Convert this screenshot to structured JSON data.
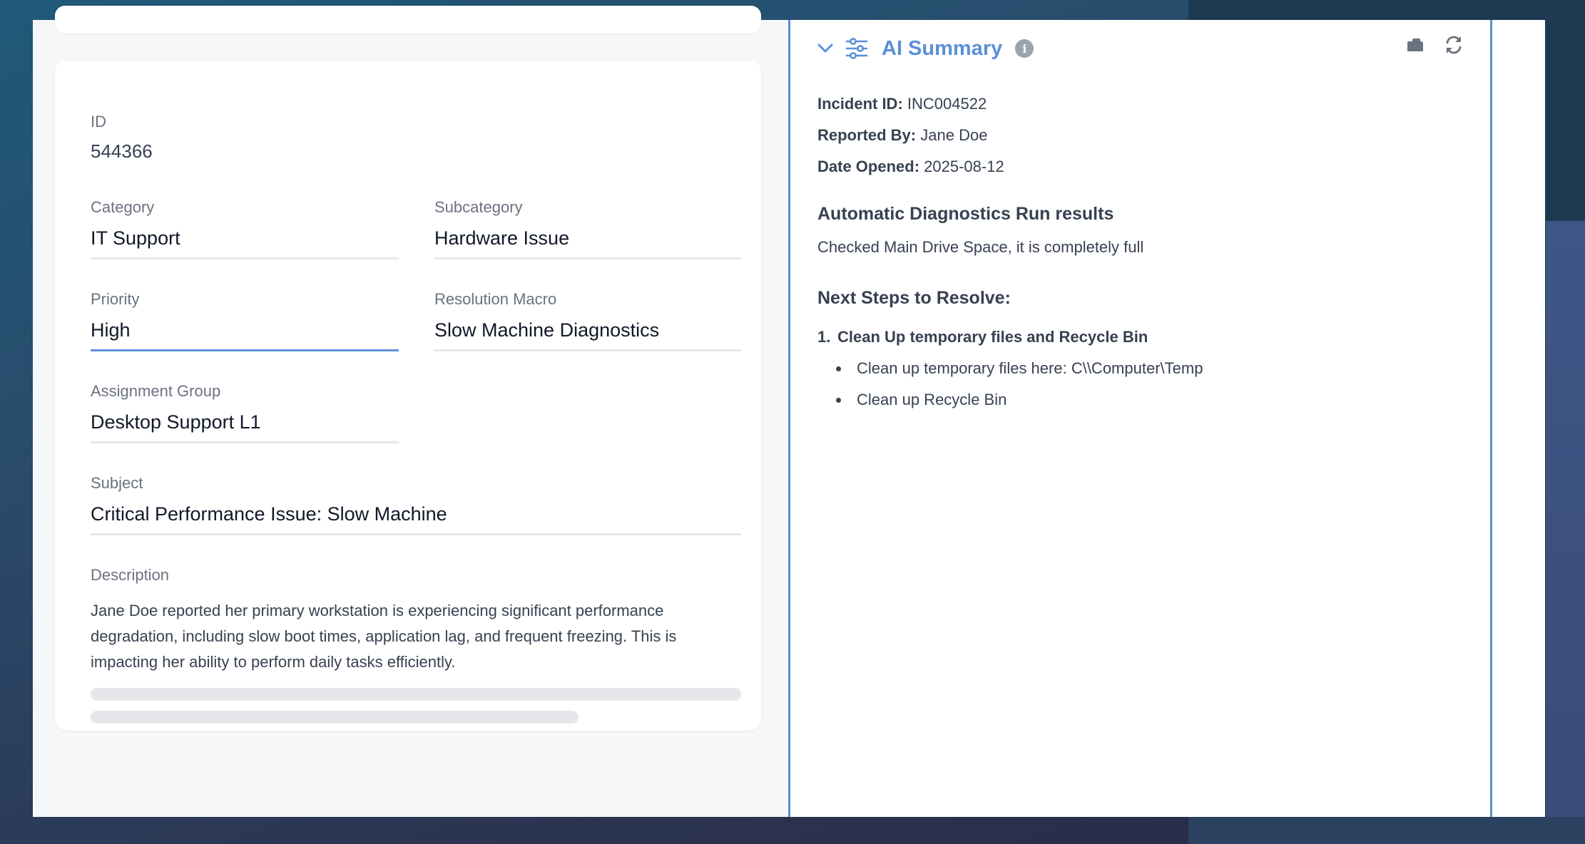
{
  "form": {
    "id": {
      "label": "ID",
      "value": "544366"
    },
    "category": {
      "label": "Category",
      "value": "IT Support"
    },
    "subcategory": {
      "label": "Subcategory",
      "value": "Hardware Issue"
    },
    "priority": {
      "label": "Priority",
      "value": "High"
    },
    "resolution_macro": {
      "label": "Resolution Macro",
      "value": "Slow Machine Diagnostics"
    },
    "assignment_group": {
      "label": "Assignment Group",
      "value": "Desktop Support L1"
    },
    "subject": {
      "label": "Subject",
      "value": "Critical Performance Issue: Slow Machine"
    },
    "description": {
      "label": "Description",
      "value": "Jane Doe reported her primary workstation is experiencing significant performance degradation, including slow boot times, application lag, and frequent freezing. This is impacting her ability to perform daily tasks efficiently."
    }
  },
  "ai_summary": {
    "title": "AI Summary",
    "info_glyph": "i",
    "meta": [
      {
        "key": "Incident ID:",
        "value": "INC004522"
      },
      {
        "key": "Reported By:",
        "value": "Jane Doe"
      },
      {
        "key": "Date Opened:",
        "value": "2025-08-12"
      }
    ],
    "diagnostics": {
      "heading": "Automatic Diagnostics Run results",
      "text": "Checked Main Drive Space, it is completely full"
    },
    "next_steps": {
      "heading": "Next Steps to Resolve:",
      "steps": [
        {
          "number": "1.",
          "title": "Clean Up temporary files and Recycle Bin",
          "bullets": [
            "Clean up temporary files here: C\\\\Computer\\Temp",
            "Clean up Recycle Bin"
          ]
        }
      ]
    }
  },
  "icons": {
    "collapse": "chevron-down-icon",
    "settings": "sliders-icon",
    "info": "info-icon",
    "copy": "copy-icon",
    "refresh": "refresh-icon"
  },
  "colors": {
    "accent": "#5b8fd6",
    "text": "#374151",
    "muted": "#6b7280"
  }
}
